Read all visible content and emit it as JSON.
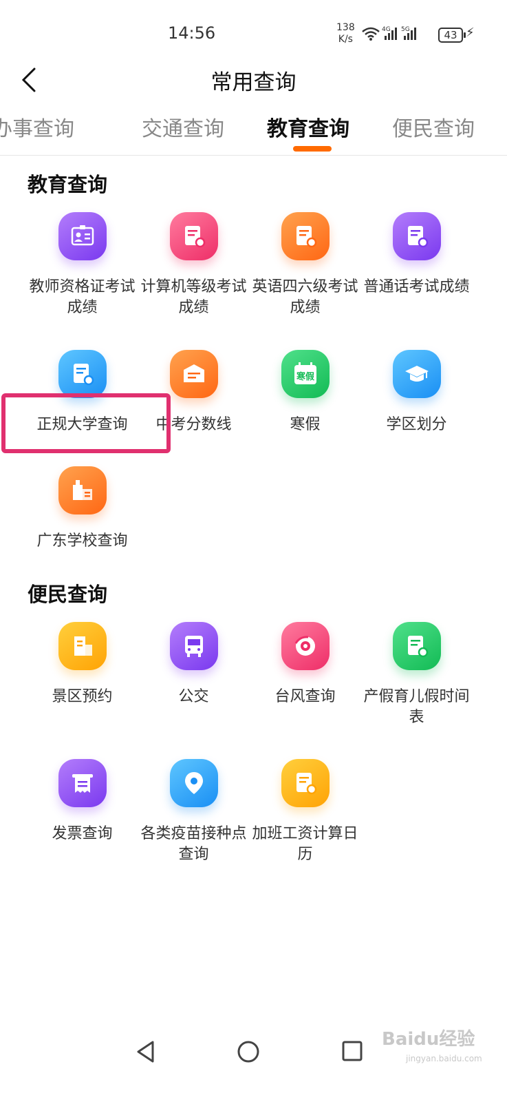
{
  "status": {
    "time": "14:56",
    "speed_value": "138",
    "speed_unit": "K/s",
    "battery": "43",
    "signal1": "4G",
    "signal2": "5G"
  },
  "header": {
    "title": "常用查询"
  },
  "tabs": [
    {
      "label": "办事查询"
    },
    {
      "label": "交通查询"
    },
    {
      "label": "教育查询",
      "active": true
    },
    {
      "label": "便民查询"
    }
  ],
  "education": {
    "title": "教育查询",
    "items": [
      {
        "label": "教师资格证考试成绩",
        "icon": "id-card-icon",
        "color": "purple"
      },
      {
        "label": "计算机等级考试成绩",
        "icon": "doc-search-icon",
        "color": "pink"
      },
      {
        "label": "英语四六级考试成绩",
        "icon": "doc-search-icon",
        "color": "orange"
      },
      {
        "label": "普通话考试成绩",
        "icon": "doc-search-icon",
        "color": "purple"
      },
      {
        "label": "正规大学查询",
        "icon": "doc-search-icon",
        "color": "blue"
      },
      {
        "label": "中考分数线",
        "icon": "envelope-icon",
        "color": "orange"
      },
      {
        "label": "寒假",
        "icon": "calendar-icon",
        "color": "green",
        "badge": "寒假"
      },
      {
        "label": "学区划分",
        "icon": "graduation-cap-icon",
        "color": "blue"
      },
      {
        "label": "广东学校查询",
        "icon": "building-icon",
        "color": "orange"
      }
    ]
  },
  "convenience": {
    "title": "便民查询",
    "items": [
      {
        "label": "景区预约",
        "icon": "building-icon",
        "color": "yellow"
      },
      {
        "label": "公交",
        "icon": "bus-icon",
        "color": "purple"
      },
      {
        "label": "台风查询",
        "icon": "typhoon-icon",
        "color": "pink"
      },
      {
        "label": "产假育儿假时间表",
        "icon": "doc-search-icon",
        "color": "green"
      },
      {
        "label": "发票查询",
        "icon": "receipt-icon",
        "color": "purple"
      },
      {
        "label": "各类疫苗接种点查询",
        "icon": "location-pin-icon",
        "color": "blue"
      },
      {
        "label": "加班工资计算日历",
        "icon": "doc-search-icon",
        "color": "yellow"
      }
    ]
  },
  "watermark": {
    "brand": "Baidu经验",
    "url": "jingyan.baidu.com"
  }
}
